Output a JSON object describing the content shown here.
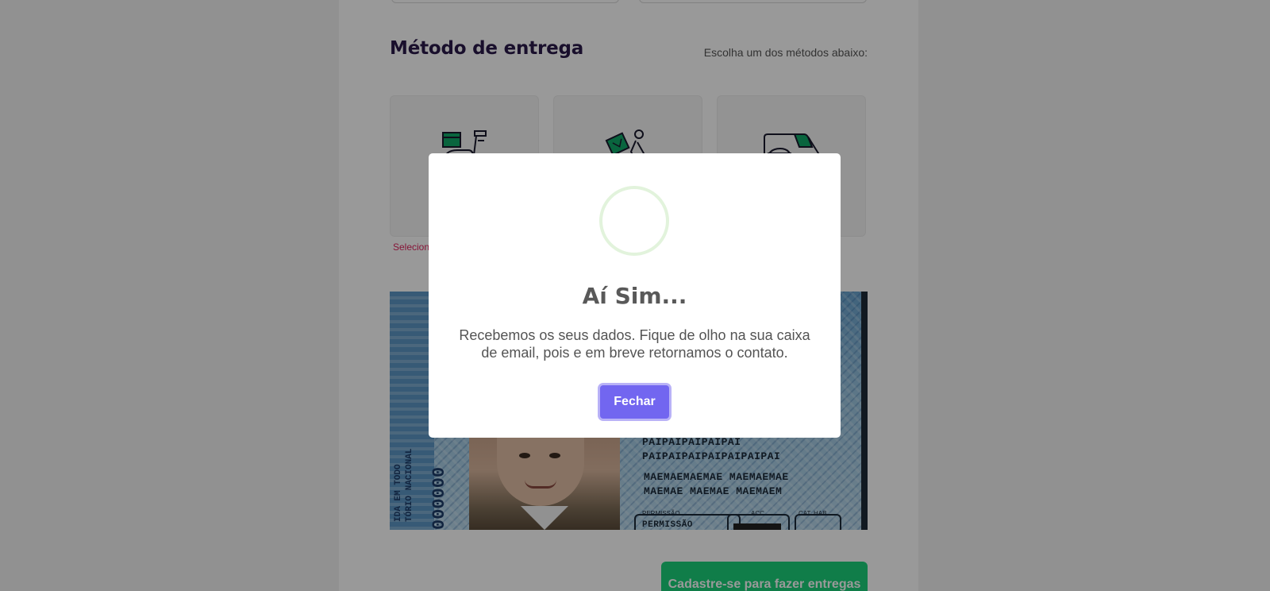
{
  "delivery": {
    "title": "Método de entrega",
    "hint": "Escolha um dos métodos abaixo:",
    "methods": [
      {
        "icon": "scooter-delivery-icon"
      },
      {
        "icon": "bicycle-courier-icon"
      },
      {
        "icon": "delivery-van-icon"
      }
    ],
    "validation_message": "Selecion"
  },
  "document": {
    "vertical_text_line1": "IDA EM TODO",
    "vertical_text_line2": "TÓRIO NACIONAL",
    "number": "000000",
    "father_line1": "PAIPAIPAIPAIPAI",
    "father_line2": "PAIPAIPAIPAIPAIPAIPAI",
    "mother_line1": "MAEMAEMAEMAE MAEMAEMAE",
    "mother_line2": "MAEMAE MAEMAE MAEMAEM",
    "permission_label": "PERMISSÃO",
    "permission_value": "PERMISSÃO",
    "acc_label": "ACC",
    "category_label": "CAT. HAB."
  },
  "cta": {
    "label": "Cadastre-se para fazer entregas"
  },
  "modal": {
    "title": "Aí Sim...",
    "text": "Recebemos os seus dados. Fique de olho na sua caixa de email, pois e em breve retornamos o contato.",
    "button_label": "Fechar",
    "icon": "success-circle-icon"
  },
  "colors": {
    "accent": "#7266f0",
    "cta_green": "#1bd07a",
    "title_dark": "#2a1a4a",
    "icon_green": "#0fa968",
    "error_pink": "#e0245e",
    "success_ring": "#e2f3dc"
  }
}
